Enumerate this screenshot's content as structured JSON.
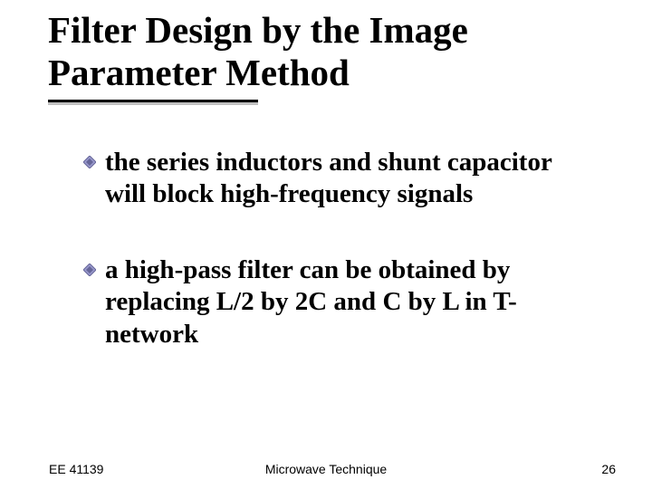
{
  "title": "Filter Design by the Image Parameter Method",
  "bullets": [
    "the series inductors and shunt capacitor will block high-frequency signals",
    "a high-pass filter can be obtained by replacing L/2 by 2C and C by L in T-network"
  ],
  "footer": {
    "left": "EE 41139",
    "center": "Microwave Technique",
    "right": "26"
  },
  "colors": {
    "bullet_fill": "#9999cc",
    "bullet_edge": "#666699"
  }
}
